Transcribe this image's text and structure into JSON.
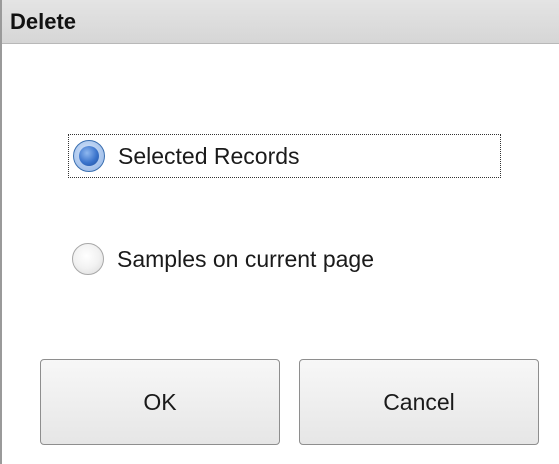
{
  "dialog": {
    "title": "Delete"
  },
  "options": [
    {
      "label": "Selected Records",
      "selected": true,
      "focused": true
    },
    {
      "label": "Samples on current page",
      "selected": false,
      "focused": false
    }
  ],
  "buttons": {
    "ok_label": "OK",
    "cancel_label": "Cancel"
  },
  "colors": {
    "radio_accent": "#3b74cc",
    "title_bar": "#dcdcdc"
  },
  "icons": {
    "selected_radio": "radio-selected-icon",
    "unselected_radio": "radio-unselected-icon"
  }
}
